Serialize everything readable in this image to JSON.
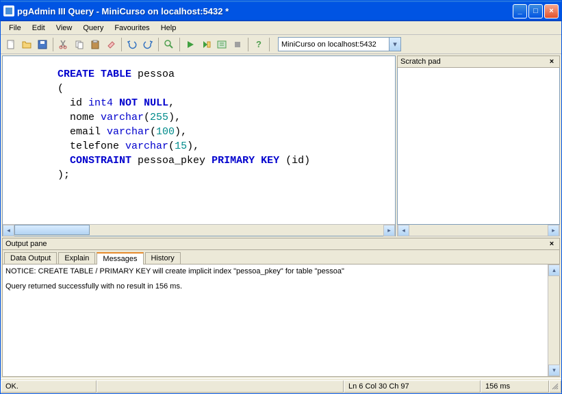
{
  "window": {
    "title": "pgAdmin III Query - MiniCurso on localhost:5432 *"
  },
  "menu": {
    "file": "File",
    "edit": "Edit",
    "view": "View",
    "query": "Query",
    "favourites": "Favourites",
    "help": "Help"
  },
  "toolbar": {
    "connection": "MiniCurso on localhost:5432",
    "icons": {
      "new": "new-file-icon",
      "open": "open-folder-icon",
      "save": "save-icon",
      "cut": "cut-icon",
      "copy": "copy-icon",
      "paste": "paste-icon",
      "clear": "eraser-icon",
      "undo": "undo-icon",
      "redo": "redo-icon",
      "find": "find-icon",
      "execute": "execute-icon",
      "execute_file": "execute-file-icon",
      "explain": "explain-icon",
      "cancel": "cancel-icon",
      "help": "help-icon"
    }
  },
  "editor": {
    "sql_tokens": [
      {
        "t": "kw1",
        "v": "CREATE"
      },
      {
        "t": "sp",
        "v": " "
      },
      {
        "t": "kw1",
        "v": "TABLE"
      },
      {
        "t": "sp",
        "v": " "
      },
      {
        "t": "id",
        "v": "pessoa"
      },
      {
        "t": "nl"
      },
      {
        "t": "id",
        "v": "("
      },
      {
        "t": "nl"
      },
      {
        "t": "sp",
        "v": "  "
      },
      {
        "t": "id",
        "v": "id"
      },
      {
        "t": "sp",
        "v": " "
      },
      {
        "t": "typ",
        "v": "int4"
      },
      {
        "t": "sp",
        "v": " "
      },
      {
        "t": "kw2",
        "v": "NOT"
      },
      {
        "t": "sp",
        "v": " "
      },
      {
        "t": "kw2",
        "v": "NULL"
      },
      {
        "t": "id",
        "v": ","
      },
      {
        "t": "nl"
      },
      {
        "t": "sp",
        "v": "  "
      },
      {
        "t": "id",
        "v": "nome"
      },
      {
        "t": "sp",
        "v": " "
      },
      {
        "t": "typ",
        "v": "varchar"
      },
      {
        "t": "id",
        "v": "("
      },
      {
        "t": "num",
        "v": "255"
      },
      {
        "t": "id",
        "v": "),"
      },
      {
        "t": "nl"
      },
      {
        "t": "sp",
        "v": "  "
      },
      {
        "t": "id",
        "v": "email"
      },
      {
        "t": "sp",
        "v": " "
      },
      {
        "t": "typ",
        "v": "varchar"
      },
      {
        "t": "id",
        "v": "("
      },
      {
        "t": "num",
        "v": "100"
      },
      {
        "t": "id",
        "v": "),"
      },
      {
        "t": "nl"
      },
      {
        "t": "sp",
        "v": "  "
      },
      {
        "t": "id",
        "v": "telefone"
      },
      {
        "t": "sp",
        "v": " "
      },
      {
        "t": "typ",
        "v": "varchar"
      },
      {
        "t": "id",
        "v": "("
      },
      {
        "t": "num",
        "v": "15"
      },
      {
        "t": "id",
        "v": "),"
      },
      {
        "t": "nl"
      },
      {
        "t": "sp",
        "v": "  "
      },
      {
        "t": "kw1",
        "v": "CONSTRAINT"
      },
      {
        "t": "sp",
        "v": " "
      },
      {
        "t": "id",
        "v": "pessoa_pkey"
      },
      {
        "t": "sp",
        "v": " "
      },
      {
        "t": "kw1",
        "v": "PRIMARY"
      },
      {
        "t": "sp",
        "v": " "
      },
      {
        "t": "kw1",
        "v": "KEY"
      },
      {
        "t": "sp",
        "v": " "
      },
      {
        "t": "id",
        "v": "("
      },
      {
        "t": "id",
        "v": "id"
      },
      {
        "t": "id",
        "v": ")"
      },
      {
        "t": "nl"
      },
      {
        "t": "id",
        "v": ");"
      }
    ]
  },
  "scratch": {
    "title": "Scratch pad"
  },
  "output": {
    "title": "Output pane",
    "tabs": {
      "data_output": "Data Output",
      "explain": "Explain",
      "messages": "Messages",
      "history": "History"
    },
    "messages": {
      "line1": "NOTICE:  CREATE TABLE / PRIMARY KEY will create implicit index \"pessoa_pkey\" for table \"pessoa\"",
      "line2": "Query returned successfully with no result in 156 ms."
    }
  },
  "status": {
    "ok": "OK.",
    "position": "Ln 6 Col 30 Ch 97",
    "time": "156 ms"
  }
}
